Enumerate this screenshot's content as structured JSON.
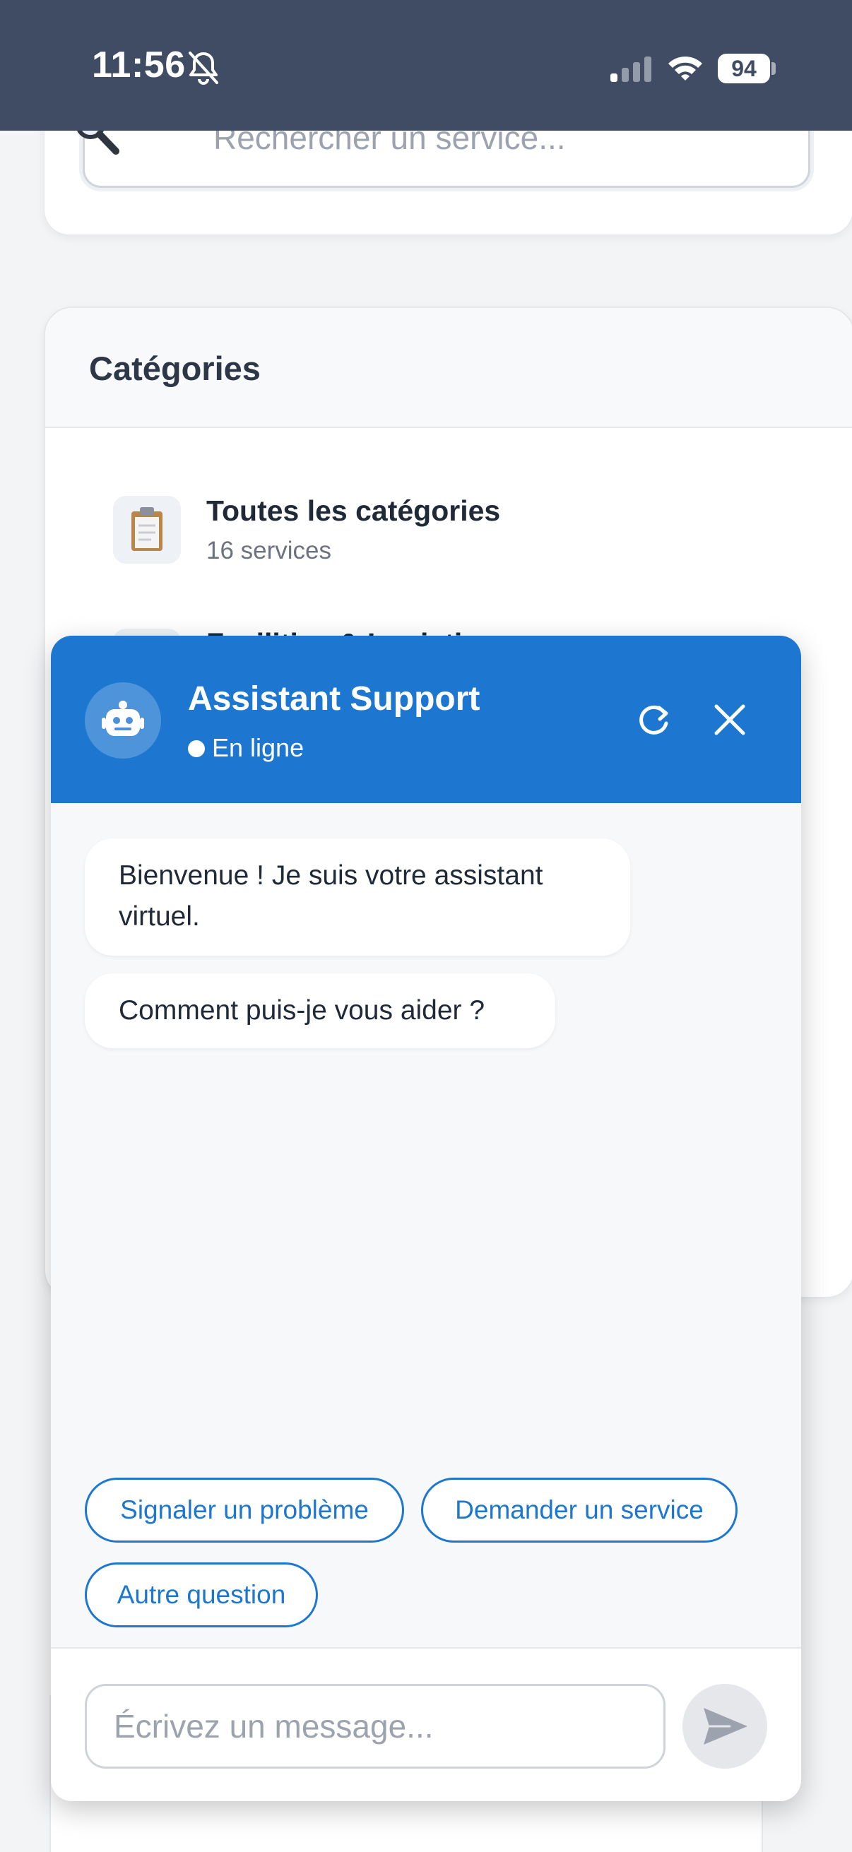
{
  "status_bar": {
    "time": "11:56",
    "battery": "94",
    "icons": [
      "bell-slash-icon",
      "cellular-signal-icon",
      "wifi-icon",
      "battery-icon"
    ]
  },
  "search": {
    "placeholder": "Rechercher un service..."
  },
  "categories": {
    "title": "Catégories",
    "items": [
      {
        "icon": "clipboard-icon",
        "label": "Toutes les catégories",
        "count": "16 services"
      },
      {
        "icon": "category-icon",
        "label": "Facilities & Logistique",
        "count": ""
      }
    ]
  },
  "chat": {
    "title": "Assistant Support",
    "status": "En ligne",
    "colors": {
      "header": "#1d77d0",
      "accent": "#1d77d0"
    },
    "messages": [
      {
        "from": "bot",
        "text": "Bienvenue ! Je suis votre assistant virtuel."
      },
      {
        "from": "bot",
        "text": "Comment puis-je vous aider ?"
      }
    ],
    "quick_replies": [
      "Signaler un problème",
      "Demander un service",
      "Autre question"
    ],
    "input": {
      "placeholder": "Écrivez un message...",
      "value": ""
    },
    "icons": {
      "avatar": "robot-icon",
      "refresh": "refresh-icon",
      "close": "close-icon",
      "send": "send-icon"
    }
  }
}
